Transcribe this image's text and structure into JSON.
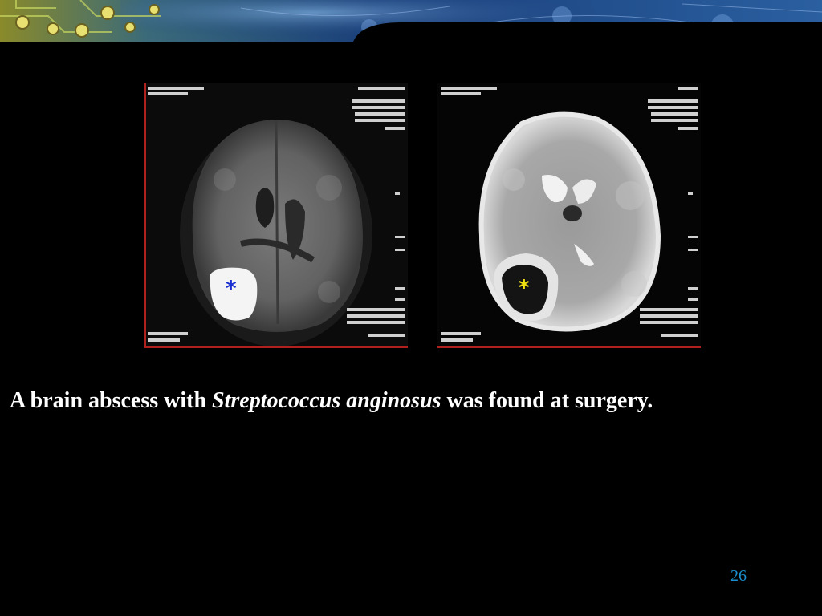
{
  "slide": {
    "caption_prefix": "A brain abscess with ",
    "caption_organism": "Streptococcus anginosus",
    "caption_suffix": " was found at surgery.",
    "page_number": "26"
  },
  "images": [
    {
      "name": "mri-dwi-scan",
      "asterisk": "*",
      "asterisk_color": "#1a2fd0"
    },
    {
      "name": "mri-adc-scan",
      "asterisk": "*",
      "asterisk_color": "#f0e010"
    }
  ],
  "colors": {
    "background": "#000000",
    "caption_text": "#ffffff",
    "page_number": "#1a90d0",
    "frame": "#b0201c"
  }
}
